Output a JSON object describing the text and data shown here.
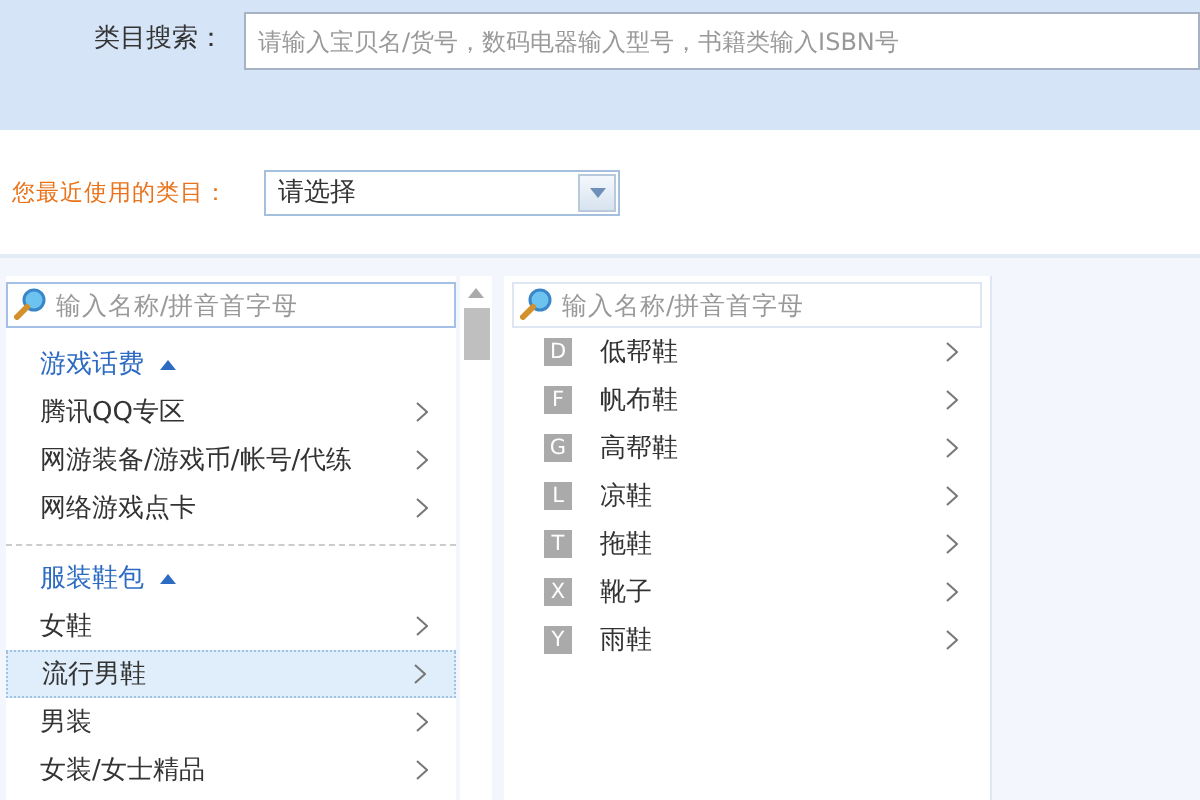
{
  "search": {
    "label": "类目搜索：",
    "placeholder": "请输入宝贝名/货号，数码电器输入型号，书籍类输入ISBN号"
  },
  "recent": {
    "label": "您最近使用的类目：",
    "value": "请选择"
  },
  "left_panel": {
    "filter_placeholder": "输入名称/拼音首字母",
    "groups": [
      {
        "title": "游戏话费",
        "expanded": true,
        "items": [
          {
            "label": "腾讯QQ专区",
            "selected": false
          },
          {
            "label": "网游装备/游戏币/帐号/代练",
            "selected": false
          },
          {
            "label": "网络游戏点卡",
            "selected": false
          }
        ]
      },
      {
        "title": "服装鞋包",
        "expanded": true,
        "items": [
          {
            "label": "女鞋",
            "selected": false
          },
          {
            "label": "流行男鞋",
            "selected": true
          },
          {
            "label": "男装",
            "selected": false
          },
          {
            "label": "女装/女士精品",
            "selected": false
          }
        ]
      }
    ]
  },
  "middle_panel": {
    "filter_placeholder": "输入名称/拼音首字母",
    "items": [
      {
        "letter": "D",
        "label": "低帮鞋"
      },
      {
        "letter": "F",
        "label": "帆布鞋"
      },
      {
        "letter": "G",
        "label": "高帮鞋"
      },
      {
        "letter": "L",
        "label": "凉鞋"
      },
      {
        "letter": "T",
        "label": "拖鞋"
      },
      {
        "letter": "X",
        "label": "靴子"
      },
      {
        "letter": "Y",
        "label": "雨鞋"
      }
    ]
  }
}
